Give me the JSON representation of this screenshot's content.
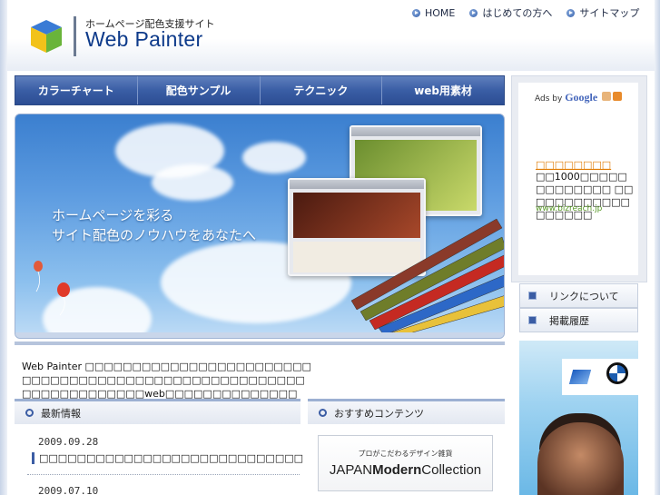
{
  "header": {
    "tagline": "ホームページ配色支援サイト",
    "title": "Web Painter",
    "links": [
      "HOME",
      "はじめての方へ",
      "サイトマップ"
    ]
  },
  "nav": {
    "tabs": [
      "カラーチャート",
      "配色サンプル",
      "テクニック",
      "web用素材"
    ]
  },
  "hero": {
    "line1": "ホームページを彩る",
    "line2": "サイト配色のノウハウをあなたへ"
  },
  "intro": {
    "text": "Web Painter □□□□□□□□□□□□□□□□□□□□□□□□□□□□□□□□□□□□□□□□□□□□□□□□□□□□□□□□□□□□□□□□□□□web□□□□□□□□□□□□□□"
  },
  "news": {
    "heading": "最新情報",
    "items": [
      {
        "date": "2009.09.28",
        "title": "□□□□□□□□□□□□□□□□□□□□□□□□□□□□"
      },
      {
        "date": "2009.07.10",
        "title": ""
      }
    ]
  },
  "recommended": {
    "heading": "おすすめコンテンツ",
    "banner_small": "プロがこだわるデザイン雑貨",
    "banner_prefix": "JAPAN",
    "banner_bold": "Modern",
    "banner_suffix": "Collection"
  },
  "ads": {
    "ads_by": "Ads by",
    "google": "Google",
    "title": "□□□□□□□□",
    "body": "□□1000□□□□□□□□□□□□□ □□□□□□□□□□□□□□□□□□",
    "url": "www.bizreach.jp"
  },
  "sidebar": {
    "links": [
      "リンクについて",
      "掲載履歴"
    ]
  },
  "colors": {
    "nav": "#3a5ea5",
    "title": "#0d3a8a",
    "accent": "#3b5da4"
  }
}
